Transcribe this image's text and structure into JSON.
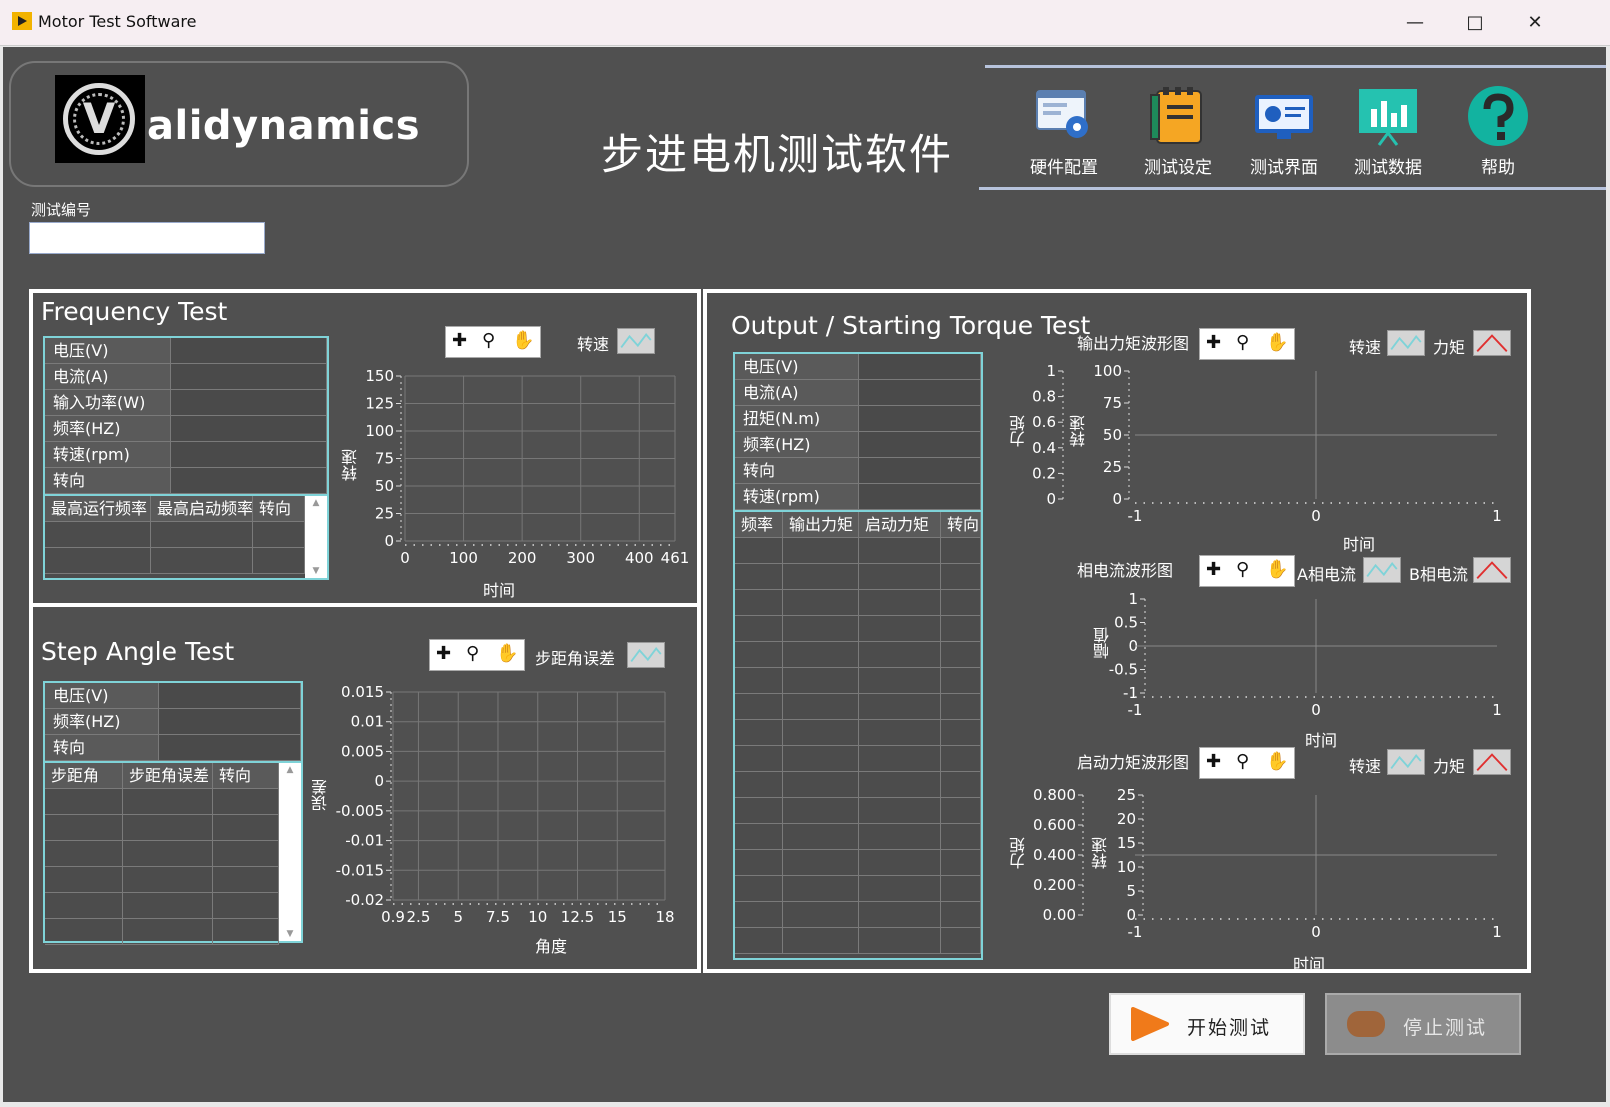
{
  "window": {
    "title": "Motor Test Software"
  },
  "header": {
    "logo_text": "alidynamics",
    "logo_letter": "V",
    "main_title": "步进电机测试软件"
  },
  "nav": [
    {
      "label": "硬件配置",
      "icon": "hardware-config-icon"
    },
    {
      "label": "测试设定",
      "icon": "test-setting-icon"
    },
    {
      "label": "测试界面",
      "icon": "test-interface-icon"
    },
    {
      "label": "测试数据",
      "icon": "test-data-icon"
    },
    {
      "label": "帮助",
      "icon": "help-icon"
    }
  ],
  "test_id": {
    "label": "测试编号",
    "value": ""
  },
  "frequency": {
    "title": "Frequency Test",
    "params": [
      "电压(V)",
      "电流(A)",
      "输入功率(W)",
      "频率(HZ)",
      "转速(rpm)",
      "转向"
    ],
    "columns": [
      "最高运行频率",
      "最高启动频率",
      "转向"
    ],
    "legend": "转速",
    "chart_data": {
      "type": "line",
      "xlabel": "时间",
      "ylabel": "转速",
      "xlim": [
        0,
        461
      ],
      "ylim": [
        0,
        150
      ],
      "x_ticks": [
        "0",
        "100",
        "200",
        "300",
        "400",
        "461"
      ],
      "y_ticks": [
        "150",
        "125",
        "100",
        "75",
        "50",
        "25",
        "0"
      ],
      "series": []
    }
  },
  "step": {
    "title": "Step Angle Test",
    "params": [
      "电压(V)",
      "频率(HZ)",
      "转向"
    ],
    "columns": [
      "步距角",
      "步距角误差",
      "转向"
    ],
    "legend": "步距角误差",
    "chart_data": {
      "type": "line",
      "xlabel": "角度",
      "ylabel": "误差",
      "xlim": [
        0.9,
        18
      ],
      "ylim": [
        -0.02,
        0.015
      ],
      "x_ticks": [
        "0.9",
        "2.5",
        "5",
        "7.5",
        "10",
        "12.5",
        "15",
        "18"
      ],
      "y_ticks": [
        "0.015",
        "0.01",
        "0.005",
        "0",
        "-0.005",
        "-0.01",
        "-0.015",
        "-0.02"
      ],
      "series": []
    }
  },
  "torque": {
    "title": "Output / Starting Torque Test",
    "params": [
      "电压(V)",
      "电流(A)",
      "扭矩(N.m)",
      "频率(HZ)",
      "转向",
      "转速(rpm)"
    ],
    "columns": [
      "频率",
      "输出力矩",
      "启动力矩",
      "转向"
    ],
    "output_chart": {
      "label": "输出力矩波形图",
      "legend_a": "转速",
      "legend_b": "力矩",
      "chart_data": {
        "type": "line",
        "xlabel": "时间",
        "ylabel_left": "力矩",
        "ylabel_right": "转速",
        "xlim": [
          -1,
          1
        ],
        "ylim_left": [
          0,
          1
        ],
        "ylim_right": [
          0,
          100
        ],
        "x_ticks": [
          "-1",
          "0",
          "1"
        ],
        "y_ticks_left": [
          "1",
          "0.8",
          "0.6",
          "0.4",
          "0.2",
          "0"
        ],
        "y_ticks_right": [
          "100",
          "75",
          "50",
          "25",
          "0"
        ],
        "series": []
      }
    },
    "phase_chart": {
      "label": "相电流波形图",
      "legend_a": "A相电流",
      "legend_b": "B相电流",
      "chart_data": {
        "type": "line",
        "xlabel": "时间",
        "ylabel": "幅值",
        "xlim": [
          -1,
          1
        ],
        "ylim": [
          -1,
          1
        ],
        "x_ticks": [
          "-1",
          "0",
          "1"
        ],
        "y_ticks": [
          "1",
          "0.5",
          "0",
          "-0.5",
          "-1"
        ],
        "series": []
      }
    },
    "start_chart": {
      "label": "启动力矩波形图",
      "legend_a": "转速",
      "legend_b": "力矩",
      "chart_data": {
        "type": "line",
        "xlabel": "时间",
        "ylabel_left": "力矩",
        "ylabel_right": "转速",
        "xlim": [
          -1,
          1
        ],
        "ylim_left": [
          0,
          0.8
        ],
        "ylim_right": [
          0,
          25
        ],
        "x_ticks": [
          "-1",
          "0",
          "1"
        ],
        "y_ticks_left": [
          "0.800",
          "0.600",
          "0.400",
          "0.200",
          "0.00"
        ],
        "y_ticks_right": [
          "25",
          "20",
          "15",
          "10",
          "5",
          "0"
        ],
        "series": []
      }
    }
  },
  "buttons": {
    "start": "开始测试",
    "stop": "停止测试"
  },
  "colors": {
    "background": "#505050",
    "table_border": "#7fd3d8",
    "start_accent": "#f07a1a",
    "stop_accent": "#a0653a"
  }
}
